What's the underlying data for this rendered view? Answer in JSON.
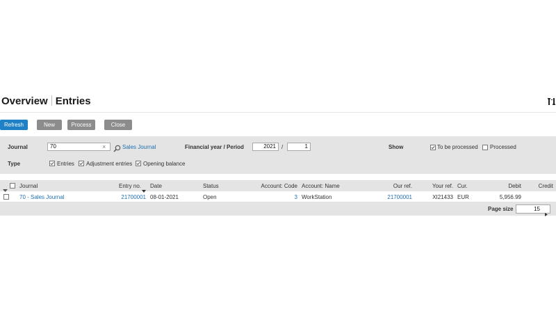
{
  "header": {
    "title_main": "Overview",
    "title_sub": "Entries",
    "settings_icon": "column-settings-icon"
  },
  "toolbar": {
    "refresh": "Refresh",
    "new": "New",
    "process": "Process",
    "close": "Close"
  },
  "filters": {
    "journal_label": "Journal",
    "journal_value": "70",
    "journal_link": "Sales Journal",
    "fy_label": "Financial year / Period",
    "year": "2021",
    "period_sep": "/",
    "period": "1",
    "show_label": "Show",
    "to_be_processed": "To be processed",
    "to_be_processed_checked": true,
    "processed": "Processed",
    "processed_checked": false,
    "type_label": "Type",
    "entries": "Entries",
    "entries_checked": true,
    "adjustment": "Adjustment entries",
    "adjustment_checked": true,
    "opening": "Opening balance",
    "opening_checked": true
  },
  "table": {
    "columns": {
      "journal": "Journal",
      "entry_no": "Entry no.",
      "date": "Date",
      "status": "Status",
      "account_code": "Account: Code",
      "account_name": "Account: Name",
      "our_ref": "Our ref.",
      "your_ref": "Your ref.",
      "cur": "Cur.",
      "debit": "Debit",
      "credit": "Credit"
    },
    "rows": [
      {
        "journal": "70 - Sales Journal",
        "entry_no": "21700001",
        "date": "08-01-2021",
        "status": "Open",
        "account_code": "3",
        "account_name": "WorkStation",
        "our_ref": "21700001",
        "your_ref": "XI21433",
        "cur": "EUR",
        "debit": "5,956.99",
        "credit": ""
      }
    ],
    "page_size_label": "Page size",
    "page_size": "15"
  }
}
